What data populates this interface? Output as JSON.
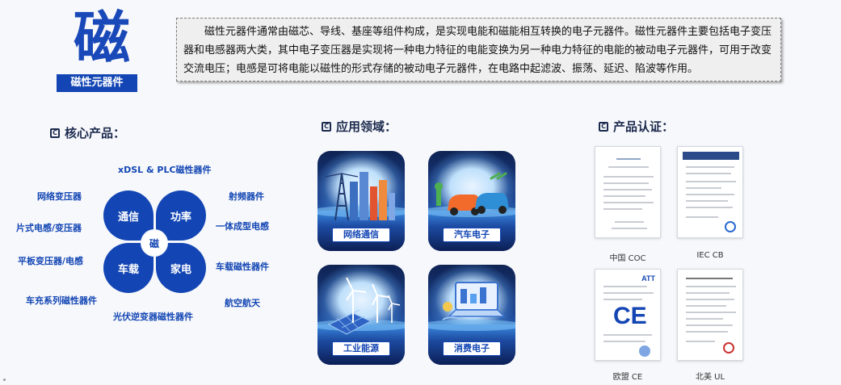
{
  "header": {
    "big_char": "磁",
    "label": "磁性元器件",
    "description": "磁性元器件通常由磁芯、导线、基座等组件构成，是实现电能和磁能相互转换的电子元器件。磁性元器件主要包括电子变压器和电感器两大类，其中电子变压器是实现将一种电力特征的电能变换为另一种电力特征的电能的被动电子元器件，可用于改变交流电压；电感是可将电能以磁性的形式存储的被动电子元器件，在电路中起滤波、振荡、延迟、陷波等作用。"
  },
  "core_products": {
    "title": "核心产品：",
    "center": "磁",
    "petals": [
      "通信",
      "功率",
      "车载",
      "家电"
    ],
    "labels": {
      "xdsl": "xDSL & PLC磁性器件",
      "network": "网络变压器",
      "chip": "片式电感/变压器",
      "planar": "平板变压器/电感",
      "charger": "车充系列磁性器件",
      "pv": "光伏逆变器磁性器件",
      "rf": "射频器件",
      "molded": "一体成型电感",
      "auto": "车载磁性器件",
      "aero": "航空航天"
    }
  },
  "applications": {
    "title": "应用领域：",
    "items": [
      "网络通信",
      "汽车电子",
      "工业能源",
      "消费电子"
    ]
  },
  "certifications": {
    "title": "产品认证：",
    "items": [
      "中国 COC",
      "IEC CB",
      "欧盟 CE",
      "北美 UL"
    ],
    "badge_ce": "CE",
    "badge_att": "ATT"
  },
  "colors": {
    "brand_blue": "#1346b4",
    "title_blue": "#1948b8",
    "navy": "#1b2a4e"
  },
  "icons": {
    "section_marker": "c-square-icon"
  }
}
